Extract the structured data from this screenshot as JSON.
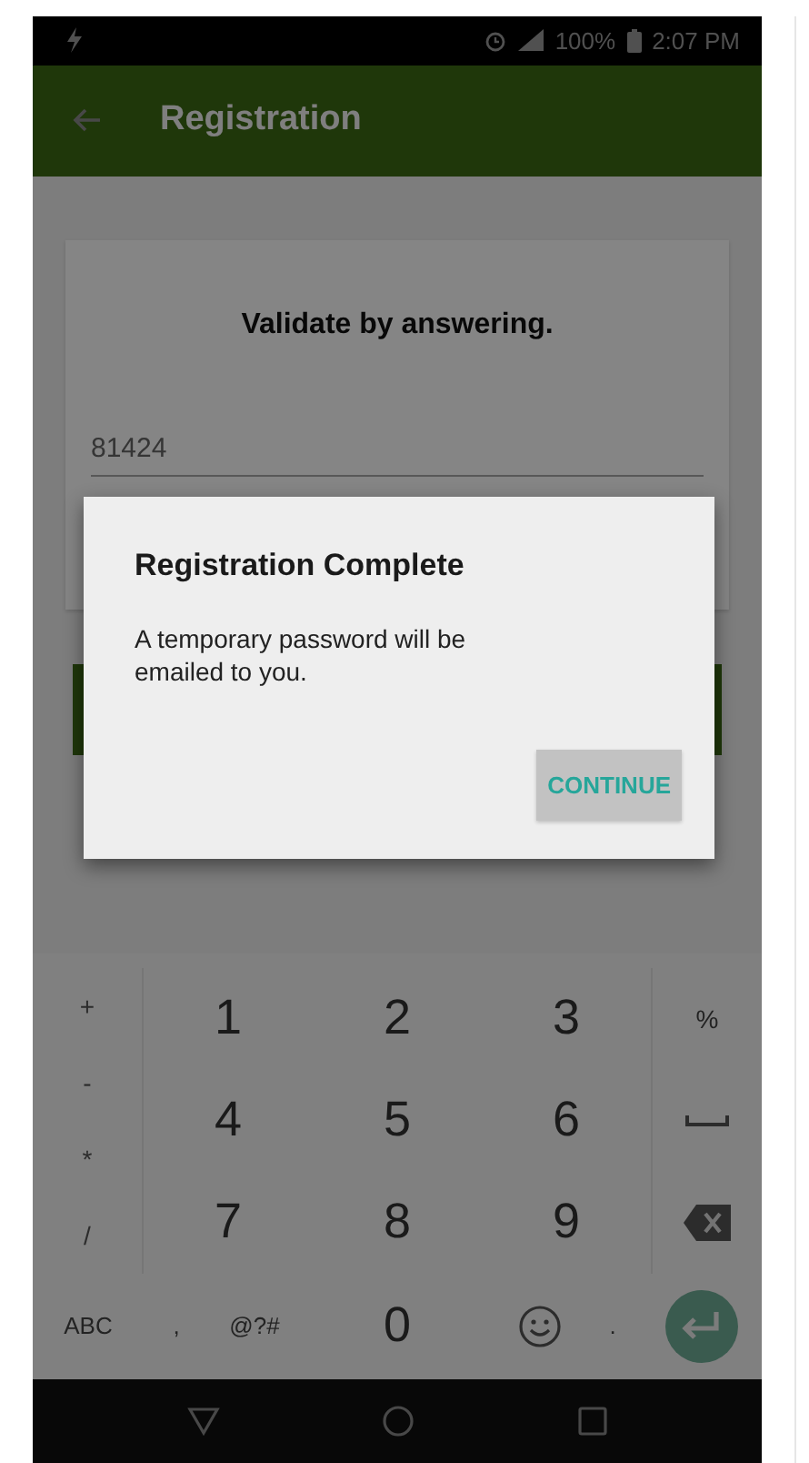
{
  "status_bar": {
    "battery": "100%",
    "time": "2:07 PM"
  },
  "app_bar": {
    "title": "Registration"
  },
  "card": {
    "prompt": "Validate by answering.",
    "answer": "81424"
  },
  "dialog": {
    "title": "Registration Complete",
    "message": "A temporary password will be emailed to you.",
    "button": "CONTINUE"
  },
  "keyboard": {
    "symbols": [
      "+",
      "-",
      "*",
      "/"
    ],
    "digit_rows": [
      [
        "1",
        "2",
        "3"
      ],
      [
        "4",
        "5",
        "6"
      ],
      [
        "7",
        "8",
        "9"
      ]
    ],
    "side_keys": [
      {
        "kind": "text",
        "label": "%"
      },
      {
        "kind": "space"
      },
      {
        "kind": "backspace"
      }
    ],
    "bottom_row": [
      {
        "kind": "text",
        "label": "ABC"
      },
      {
        "kind": "text",
        "label": ","
      },
      {
        "kind": "text",
        "label": "@?#"
      },
      {
        "kind": "digit",
        "label": "0"
      },
      {
        "kind": "emoji"
      },
      {
        "kind": "text",
        "label": "."
      },
      {
        "kind": "enter"
      }
    ]
  }
}
